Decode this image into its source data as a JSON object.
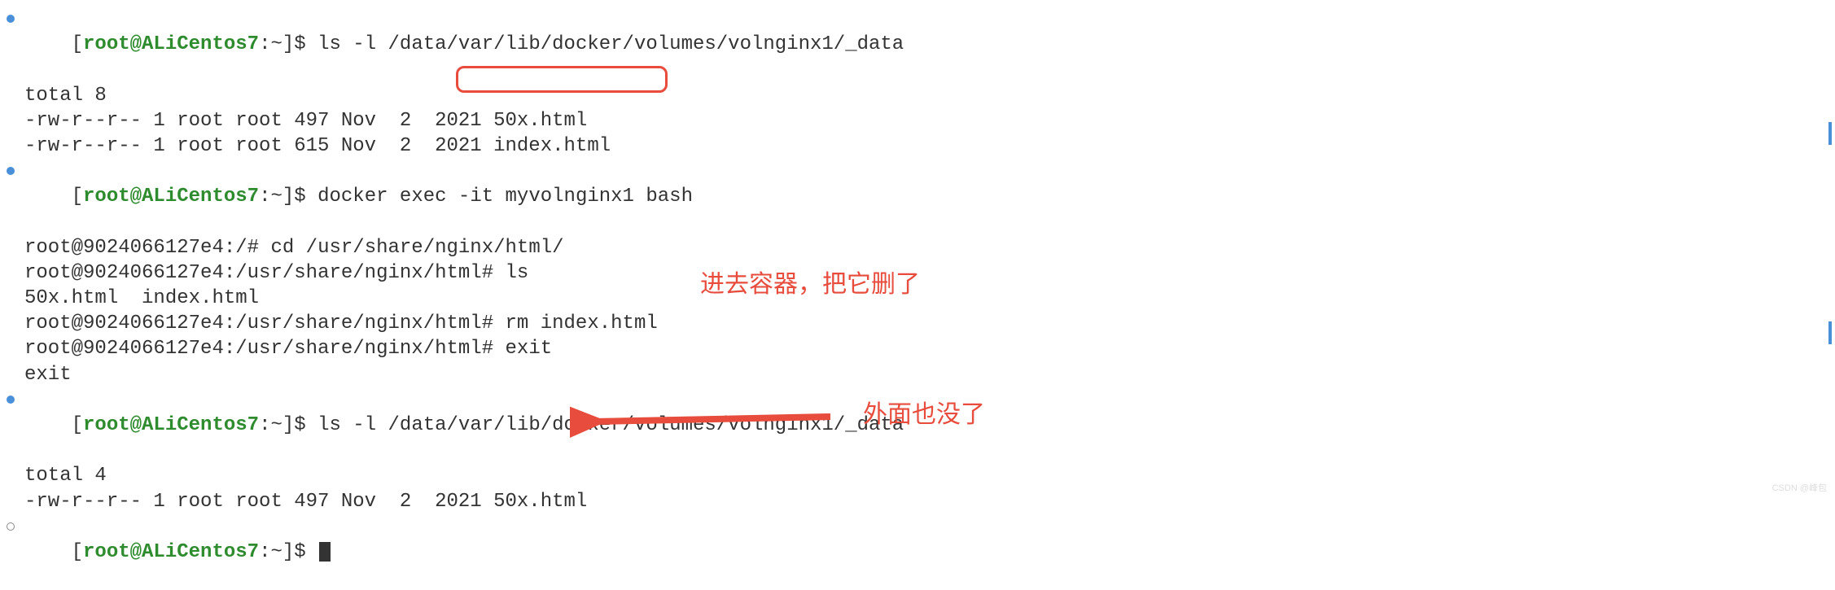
{
  "prompt": {
    "user_host": "root@ALiCentos7",
    "path": "~",
    "symbol": "$"
  },
  "container_prompt": {
    "prefix": "root@9024066127e4:",
    "path1": "/#",
    "path2": "/usr/share/nginx/html#"
  },
  "commands": {
    "ls1": "ls -l /data/var/lib/docker/volumes/volnginx1/_data",
    "docker_exec": "docker exec -it myvolnginx1 bash",
    "cd": "cd /usr/share/nginx/html/",
    "ls_inner": "ls",
    "rm": "rm index.html",
    "exit": "exit",
    "ls2": "ls -l /data/var/lib/docker/volumes/volnginx1/_data"
  },
  "outputs": {
    "total1": "total 8",
    "file1": "-rw-r--r-- 1 root root 497 Nov  2  2021 50x.html",
    "file2": "-rw-r--r-- 1 root root 615 Nov  2  2021 index.html",
    "ls_files": "50x.html  index.html",
    "exit_echo": "exit",
    "total2": "total 4",
    "file3": "-rw-r--r-- 1 root root 497 Nov  2  2021 50x.html"
  },
  "annotations": {
    "note1": "进去容器，把它删了",
    "note2": "外面也没了"
  },
  "watermark": "CSDN @峰包"
}
